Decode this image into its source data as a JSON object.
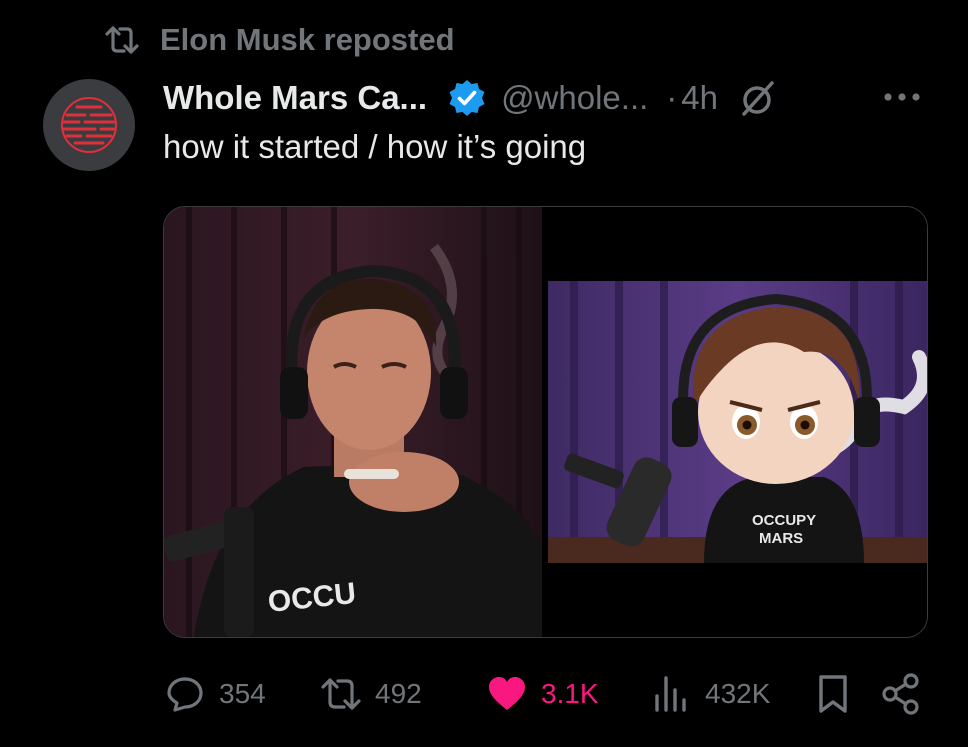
{
  "repost": {
    "text": "Elon Musk reposted"
  },
  "tweet": {
    "display_name": "Whole Mars Ca...",
    "handle": "@whole...",
    "separator": "·",
    "time": "4h",
    "text": "how it started / how it’s going"
  },
  "media": {
    "left_shirt_text": "OCCU",
    "right_shirt_line1": "OCCUPY",
    "right_shirt_line2": "MARS"
  },
  "actions": {
    "replies": "354",
    "reposts": "492",
    "likes": "3.1K",
    "views": "432K"
  },
  "colors": {
    "background": "#000000",
    "secondary_text": "#71767b",
    "verified_blue": "#1d9bf0",
    "like_pink": "#f91880",
    "avatar_red": "#e0303a"
  },
  "icons": [
    "repost-icon",
    "verified-badge-icon",
    "grok-icon",
    "more-icon",
    "reply-icon",
    "like-icon",
    "views-icon",
    "bookmark-icon",
    "share-icon"
  ]
}
